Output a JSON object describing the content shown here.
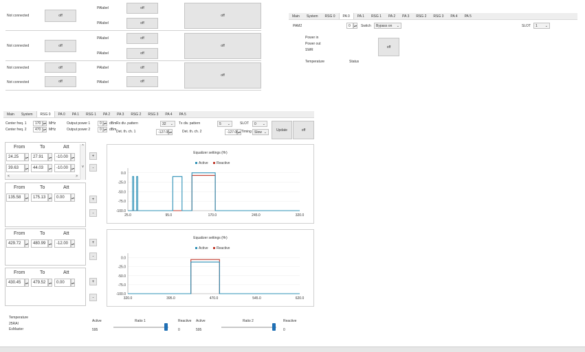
{
  "top_table": {
    "rows": [
      {
        "status": "Not connected",
        "btn": "off",
        "label_a": "PAlabel",
        "btn_a": "off",
        "label_b": "PAlabel",
        "btn_b": "off"
      },
      {
        "status": "Not connected",
        "btn": "off",
        "label_a": "PAlabel",
        "btn_a": "off",
        "label_b": "PAlabel",
        "btn_b": "off"
      },
      {
        "status": "Not connected",
        "btn": "off",
        "label_a": "PAlabel",
        "btn_a": "off"
      },
      {
        "status": "Not connected",
        "btn": "off",
        "label_a": "PAlabel",
        "btn_a": "off"
      }
    ],
    "big_buttons": [
      "off",
      "off",
      "off"
    ]
  },
  "pa_panel": {
    "tabs": [
      "Main",
      "System",
      "RSG 0",
      "PA 0",
      "PA 1",
      "RSG 1",
      "PA 2",
      "PA 3",
      "RSG 2",
      "RSG 3",
      "PA 4",
      "PA 5"
    ],
    "active_tab": 3,
    "name": "PAM2",
    "value": "0",
    "switch_label": "Switch",
    "switch_value": "Bypass on",
    "slot_label": "SLOT",
    "slot_value": "1",
    "power_in": "Power in",
    "power_out": "Power out",
    "swr": "SWR",
    "off_button": "off",
    "temperature": "Temperature",
    "status": "Status"
  },
  "rsg_panel": {
    "tabs": [
      "Main",
      "System",
      "RSG 0",
      "PA 0",
      "PA 1",
      "RSG 1",
      "PA 2",
      "PA 3",
      "RSG 2",
      "RSG 3",
      "PA 4",
      "PA 5"
    ],
    "active_tab": 2,
    "center_freq_1_label": "Center freq. 1",
    "center_freq_1": "170",
    "center_freq_2_label": "Center freq. 2",
    "center_freq_2": "470",
    "mhz": "MHz",
    "output_power_1_label": "Output power 1",
    "output_power_1": "0",
    "output_power_2_label": "Output power 2",
    "output_power_2": "0",
    "dbm": "dBm",
    "rx_div_label": "Rx div. pattern",
    "rx_div_value": "32",
    "tx_div_label": "Tx div. pattern",
    "tx_div_value": "5",
    "slot_label": "SLOT",
    "slot_value": "0",
    "det_th_1_label": "Det. th. ch. 1",
    "det_th_1": "-127.00",
    "det_th_2_label": "Det. th. ch. 2",
    "det_th_2": "-127.00",
    "timing_label": "Timing",
    "timing_value": "Slow",
    "update_button": "Update",
    "off_button": "off"
  },
  "equalizer": {
    "headers": {
      "from": "From",
      "to": "To",
      "att": "Att"
    },
    "group1": [
      {
        "from": "24.25",
        "to": "27.91",
        "att": "-10.00"
      },
      {
        "from": "39.63",
        "to": "44.03",
        "att": "-10.00"
      }
    ],
    "group2": [
      {
        "from": "135.58",
        "to": "175.13",
        "att": "0.00"
      }
    ],
    "group3": [
      {
        "from": "429.72",
        "to": "480.99",
        "att": "-12.00"
      }
    ],
    "group4": [
      {
        "from": "430.45",
        "to": "479.52",
        "att": "0.00"
      }
    ],
    "side_buttons": [
      "+",
      "-",
      "+",
      "-",
      "+",
      "-",
      "+",
      "-"
    ]
  },
  "chart_data": [
    {
      "type": "line",
      "title": "Equalizer settings (Hr)",
      "legend": [
        "Active",
        "Reactive"
      ],
      "legend_position": "top-center",
      "xlim": [
        25,
        320
      ],
      "ylim": [
        -100,
        5
      ],
      "xticks": [
        "25.0",
        "95.0",
        "170.0",
        "245.0",
        "320.0"
      ],
      "yticks": [
        "0.0",
        "-25.0",
        "-50.0",
        "-75.0",
        "-100.0"
      ],
      "series": [
        {
          "name": "Active",
          "color": "#2a8fb5",
          "x": [
            25,
            33,
            33,
            35,
            35,
            40,
            40,
            42,
            42,
            102,
            102,
            118,
            118,
            135,
            135,
            175,
            175,
            320
          ],
          "y": [
            -100,
            -100,
            -10,
            -10,
            -100,
            -100,
            -10,
            -10,
            -100,
            -100,
            -10,
            -10,
            -100,
            -100,
            0,
            0,
            -100,
            -100
          ]
        },
        {
          "name": "Reactive",
          "color": "#c0392b",
          "x": [
            25,
            135,
            135,
            175,
            175,
            320
          ],
          "y": [
            -100,
            -100,
            -7,
            -7,
            -100,
            -100
          ]
        }
      ]
    },
    {
      "type": "line",
      "title": "Equalizer settings (Hr)",
      "legend": [
        "Active",
        "Reactive"
      ],
      "legend_position": "top-center",
      "xlim": [
        320,
        620
      ],
      "ylim": [
        -100,
        5
      ],
      "xticks": [
        "320.0",
        "395.0",
        "470.0",
        "545.0",
        "620.0"
      ],
      "yticks": [
        "0.0",
        "-25.0",
        "-50.0",
        "-75.0",
        "-100.0"
      ],
      "series": [
        {
          "name": "Active",
          "color": "#2a8fb5",
          "x": [
            320,
            430,
            430,
            480,
            480,
            620
          ],
          "y": [
            -100,
            -100,
            -12,
            -12,
            -100,
            -100
          ]
        },
        {
          "name": "Reactive",
          "color": "#c0392b",
          "x": [
            320,
            430,
            430,
            480,
            480,
            620
          ],
          "y": [
            -100,
            -100,
            -5,
            -5,
            -100,
            -100
          ]
        }
      ]
    }
  ],
  "bottom": {
    "temperature": "Temperature",
    "temp_value": "25RAI",
    "master_label": "EsMaster",
    "active_1": "Active",
    "active_1_val": "595",
    "ratio_1": "Ratio 1",
    "ratio_1_value": 0.95,
    "reactive_1": "Reactive",
    "reactive_1_val": "0",
    "active_2": "Active",
    "active_2_val": "595",
    "ratio_2": "Ratio 2",
    "ratio_2_value": 0.95,
    "reactive_2": "Reactive",
    "reactive_2_val": "0"
  },
  "colors": {
    "active": "#2a8fb5",
    "reactive": "#c0392b",
    "slider": "#1f6fb4"
  }
}
